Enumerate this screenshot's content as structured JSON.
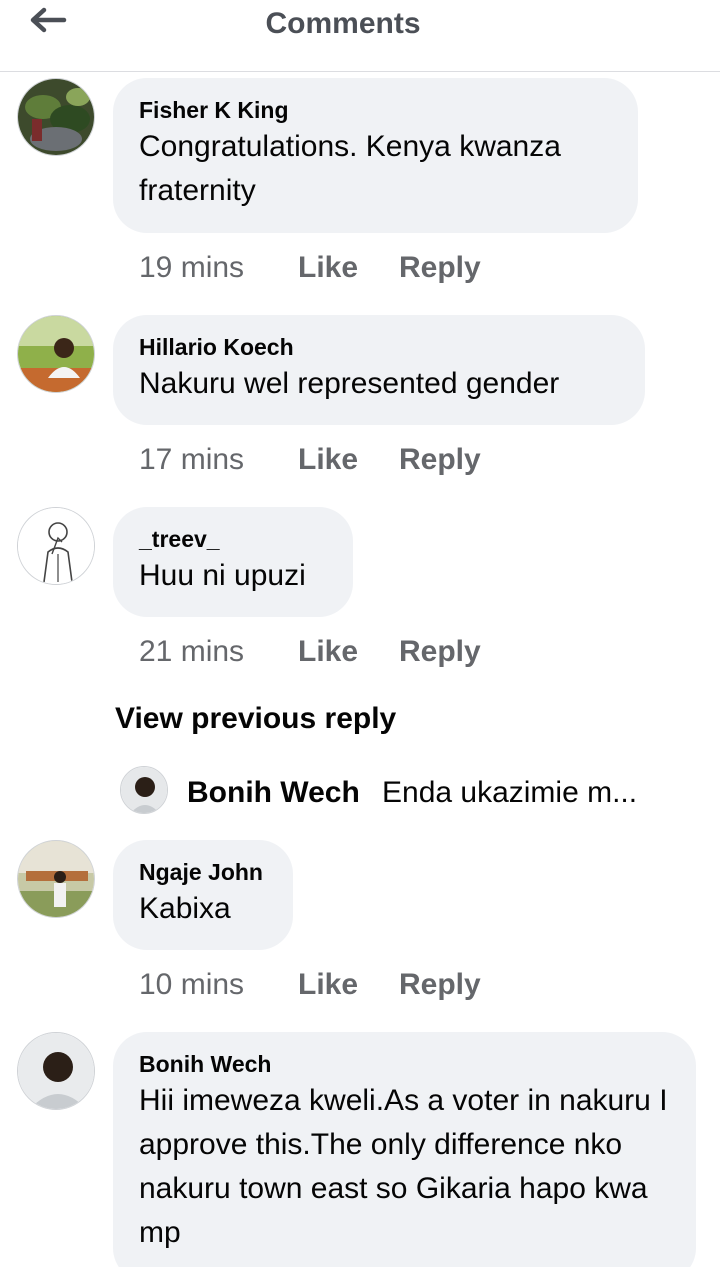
{
  "header": {
    "title": "Comments",
    "back_icon": "arrow-left-icon"
  },
  "comments_top": [
    {
      "author": "Fisher K King",
      "text": "Congratulations. Kenya kwanza fraternity",
      "time": "19 mins",
      "like": "Like",
      "reply": "Reply"
    },
    {
      "author": "Hillario Koech",
      "text": "Nakuru wel represented  gender",
      "time": "17 mins",
      "like": "Like",
      "reply": "Reply"
    },
    {
      "author": "_treev_",
      "text": "Huu ni upuzi",
      "time": "21 mins",
      "like": "Like",
      "reply": "Reply"
    }
  ],
  "thread": {
    "view_previous": "View previous reply",
    "preview_author": "Bonih Wech",
    "preview_text": "Enda ukazimie m..."
  },
  "comments_bottom": [
    {
      "author": "Ngaje John",
      "text": "Kabixa",
      "time": "10 mins",
      "like": "Like",
      "reply": "Reply"
    },
    {
      "author": "Bonih Wech",
      "text": "Hii imeweza kweli.As a voter in nakuru I approve this.The only difference nko nakuru town east so Gikaria hapo kwa mp"
    }
  ],
  "colors": {
    "bubble": "#f0f2f5",
    "meta_text": "#65676b",
    "title": "#4b4f56"
  }
}
